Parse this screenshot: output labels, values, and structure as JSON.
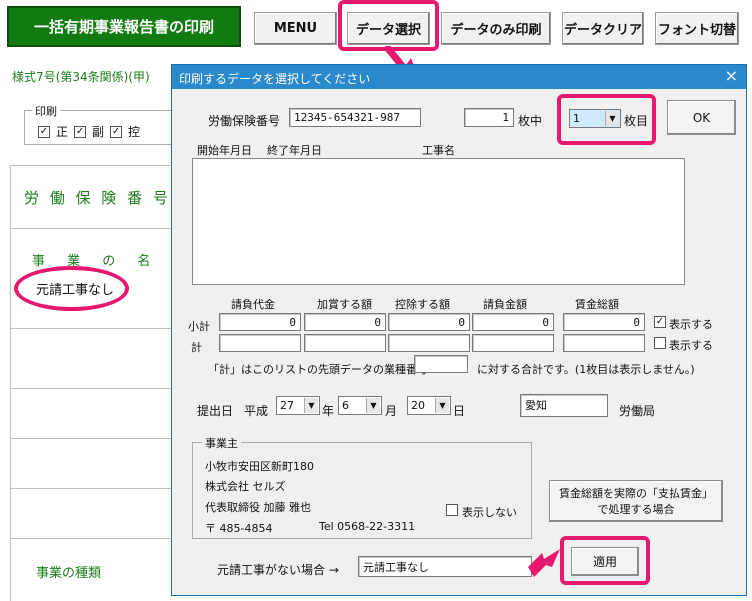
{
  "toolbar": {
    "title": "一括有期事業報告書の印刷",
    "menu": "MENU",
    "select_data": "データ選択",
    "print_data_only": "データのみ印刷",
    "clear_data": "データクリア",
    "switch_font": "フォント切替"
  },
  "sheet": {
    "form_label": "様式7号(第34条関係)(甲)",
    "print_group": "印刷",
    "print_checks": [
      "正",
      "副",
      "控"
    ],
    "labor_insurance_label": "労 働 保 険 番 号",
    "business_name_label": "事 業 の 名 称",
    "no_subcontract_value": "元請工事なし",
    "business_type_label": "事業の種類"
  },
  "dialog": {
    "title": "印刷するデータを選択してください",
    "close": "×",
    "insurance_no_label": "労働保険番号",
    "insurance_no": "12345-654321-987",
    "sheets_total": "1",
    "sheets_unit": "枚中",
    "sheet_selected": "1",
    "sheet_unit": "枚目",
    "ok": "OK",
    "list_headers": {
      "start": "開始年月日",
      "end": "終了年月日",
      "name": "工事名"
    },
    "columns": [
      "請負代金",
      "加賞する額",
      "控除する額",
      "請負金額",
      "賃金総額"
    ],
    "subtotal_label": "小計",
    "total_label": "計",
    "subtotal_values": [
      "0",
      "0",
      "0",
      "0",
      "0"
    ],
    "show_subtotal": "表示する",
    "show_total": "表示する",
    "note_prefix": "「計」はこのリストの先頭データの業種番号",
    "note_suffix": "に対する合計です。(1枚目は表示しません。)",
    "submit_label": "提出日",
    "era": "平成",
    "year": "27",
    "year_unit": "年",
    "month": "6",
    "month_unit": "月",
    "day": "20",
    "day_unit": "日",
    "bureau_value": "愛知",
    "bureau_label": "労働局",
    "employer_group": "事業主",
    "employer_address": "小牧市安田区新町180",
    "employer_company": "株式会社 セルズ",
    "employer_rep": "代表取締役 加藤 雅也",
    "employer_postal": "〒 485-4854",
    "employer_tel": "Tel  0568-22-3311",
    "hide_employer": "表示しない",
    "wage_button": "賃金総額を実際の「支払賃金」で処理する場合",
    "no_subcontract_label": "元請工事がない場合 →",
    "no_subcontract_value": "元請工事なし",
    "apply": "適用"
  }
}
